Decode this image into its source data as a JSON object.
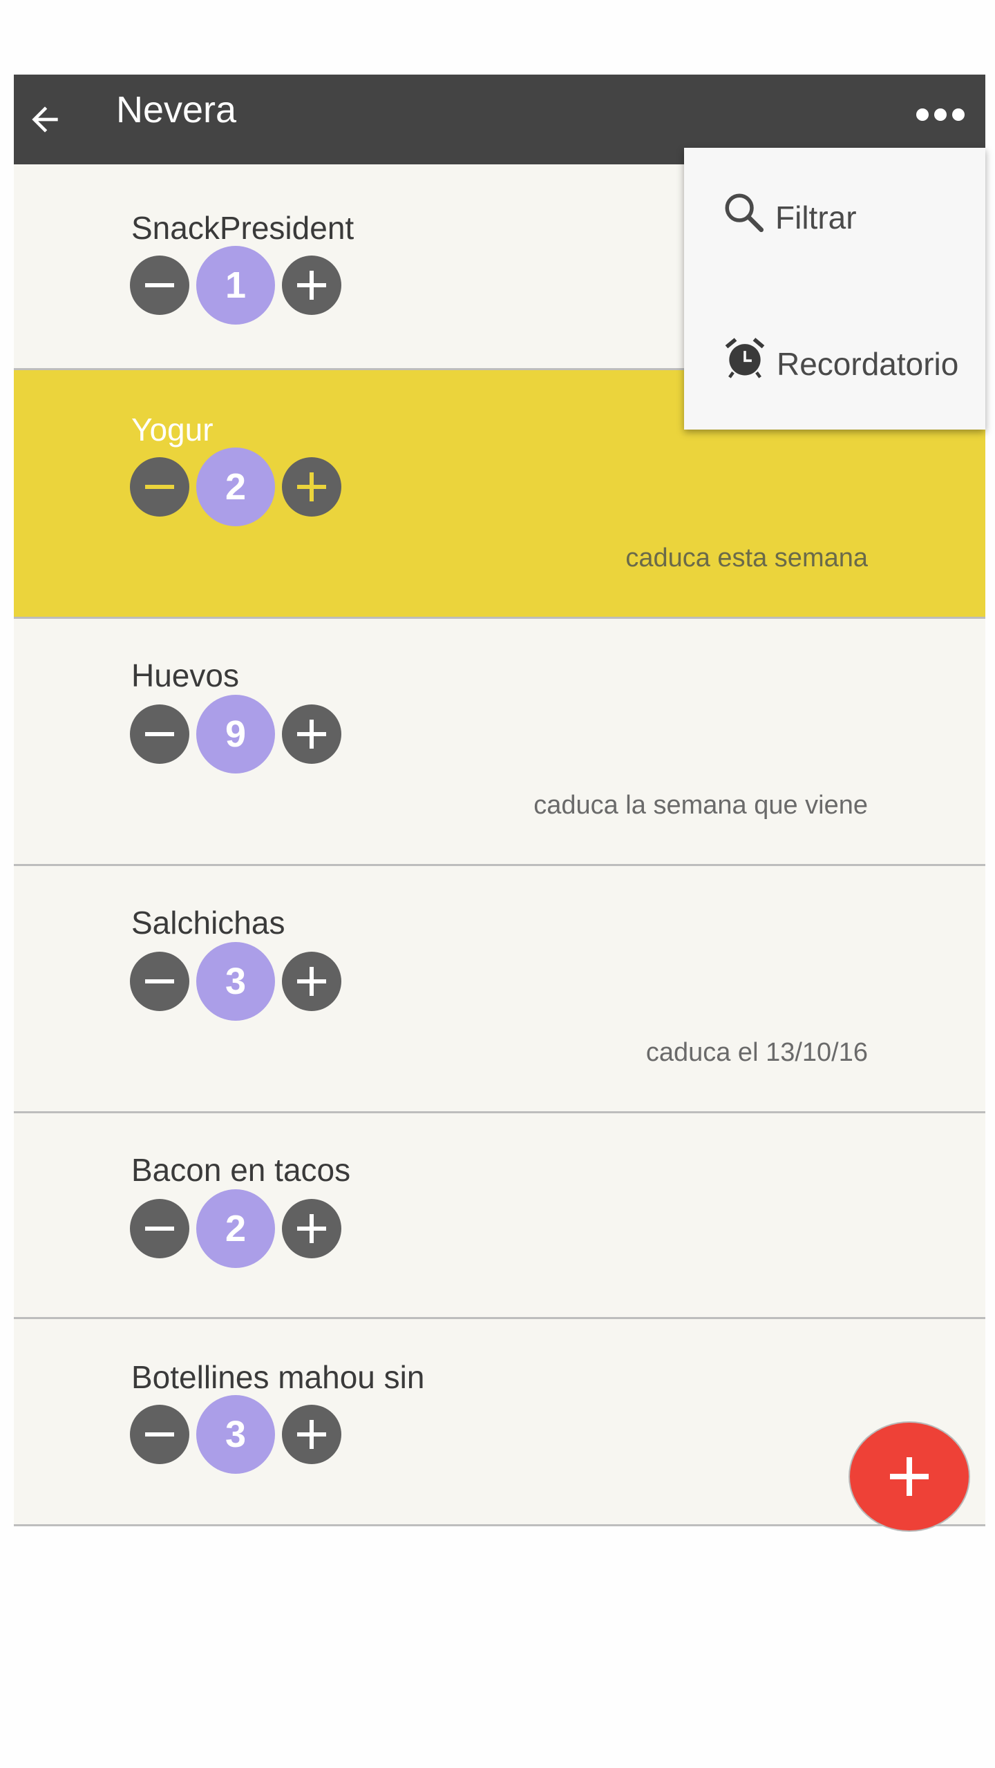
{
  "appbar": {
    "title": "Nevera",
    "back_icon": "arrow-left-icon",
    "more_icon": "more-horizontal-icon"
  },
  "colors": {
    "appbar": "#444444",
    "row_background": "#f7f6f1",
    "highlight": "#ebd43c",
    "quantity_bubble": "#ab9ee8",
    "stepper_button": "#616161",
    "fab": "#ee4137"
  },
  "items": [
    {
      "name": "SnackPresident",
      "quantity": "1",
      "expiry": ""
    },
    {
      "name": "Yogur",
      "quantity": "2",
      "expiry": "caduca esta semana",
      "highlighted": true
    },
    {
      "name": "Huevos",
      "quantity": "9",
      "expiry": "caduca la semana que viene"
    },
    {
      "name": "Salchichas",
      "quantity": "3",
      "expiry": "caduca el 13/10/16"
    },
    {
      "name": "Bacon en tacos",
      "quantity": "2",
      "expiry": ""
    },
    {
      "name": "Botellines mahou sin",
      "quantity": "3",
      "expiry": ""
    }
  ],
  "menu": {
    "items": [
      {
        "label": "Filtrar",
        "icon": "search-icon"
      },
      {
        "label": "Recordatorio",
        "icon": "alarm-clock-icon"
      }
    ]
  },
  "fab": {
    "icon": "plus-icon"
  }
}
